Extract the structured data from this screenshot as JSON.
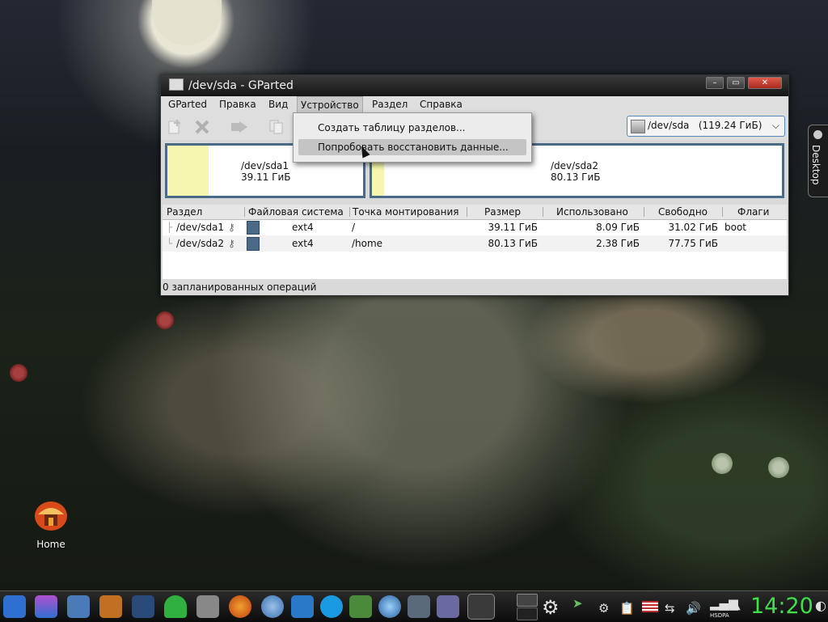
{
  "window": {
    "title": "/dev/sda - GParted"
  },
  "menubar": {
    "items": [
      "GParted",
      "Правка",
      "Вид",
      "Устройство",
      "Раздел",
      "Справка"
    ],
    "open_index": 3
  },
  "device_select": {
    "value": "/dev/sda   (119.24 ГиБ)"
  },
  "dropdown": {
    "items": [
      "Создать таблицу разделов...",
      "Попробовать восстановить данные..."
    ],
    "highlighted_index": 1
  },
  "disk_map": [
    {
      "name": "/dev/sda1",
      "size": "39.11 ГиБ",
      "used_fraction": 0.21
    },
    {
      "name": "/dev/sda2",
      "size": "80.13 ГиБ",
      "used_fraction": 0.03
    }
  ],
  "table": {
    "headers": [
      "Раздел",
      "Файловая система",
      "Точка монтирования",
      "Размер",
      "Использовано",
      "Свободно",
      "Флаги"
    ],
    "rows": [
      {
        "partition": "/dev/sda1",
        "fs": "ext4",
        "mount": "/",
        "size": "39.11 ГиБ",
        "used": "8.09 ГиБ",
        "free": "31.02 ГиБ",
        "flags": "boot"
      },
      {
        "partition": "/dev/sda2",
        "fs": "ext4",
        "mount": "/home",
        "size": "80.13 ГиБ",
        "used": "2.38 ГиБ",
        "free": "77.75 ГиБ",
        "flags": ""
      }
    ]
  },
  "status": {
    "text": "0 запланированных операций"
  },
  "desktop": {
    "home_label": "Home",
    "side_tab_label": "Desktop"
  },
  "taskbar": {
    "clock": "14:20",
    "network_label": "HSDPA"
  },
  "colors": {
    "clock": "#3fe04a",
    "partition_border": "#4a6a8a",
    "used_space": "#f6f6b0",
    "fs_ext4": "#4a6a88",
    "close_button": "#c8392b"
  }
}
